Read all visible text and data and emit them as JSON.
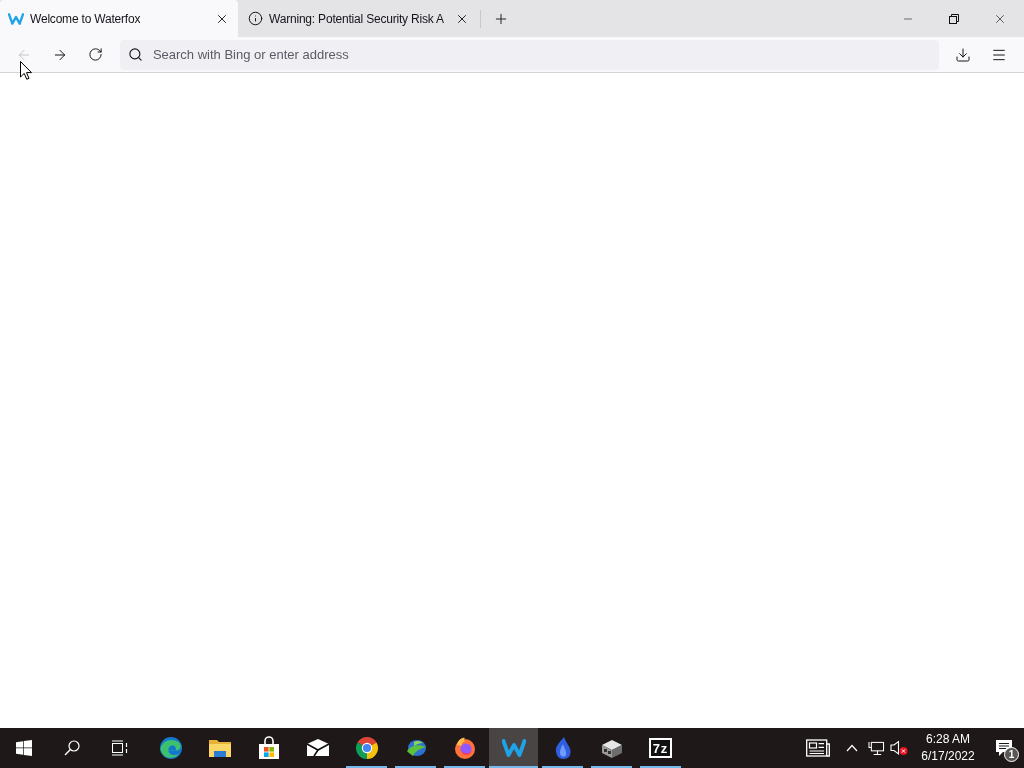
{
  "tabs": [
    {
      "kind": "waterfox",
      "title": "Welcome to Waterfox",
      "selected": true
    },
    {
      "kind": "info",
      "title": "Warning: Potential Security Risk A",
      "selected": false
    }
  ],
  "toolbar": {
    "back": {
      "disabled": true
    },
    "forward": {
      "disabled": false
    },
    "address": {
      "placeholder": "Search with Bing or enter address"
    }
  },
  "taskbar": {
    "apps": [
      {
        "kind": "edge",
        "running": false,
        "selected": false
      },
      {
        "kind": "explorer",
        "running": false,
        "selected": false
      },
      {
        "kind": "store",
        "running": false,
        "selected": false
      },
      {
        "kind": "mail",
        "running": false,
        "selected": false
      },
      {
        "kind": "chrome",
        "running": true,
        "selected": false
      },
      {
        "kind": "idm",
        "running": true,
        "selected": false
      },
      {
        "kind": "firefox",
        "running": true,
        "selected": false
      },
      {
        "kind": "waterfox",
        "running": true,
        "selected": true
      },
      {
        "kind": "drop",
        "running": true,
        "selected": false
      },
      {
        "kind": "cube",
        "running": true,
        "selected": false
      },
      {
        "kind": "sevenzip",
        "label": "7z",
        "running": true,
        "selected": false
      }
    ],
    "tray": {
      "volume": {
        "muted": true
      },
      "time": "6:28 AM",
      "date": "6/17/2022",
      "notification_count": "1"
    }
  }
}
